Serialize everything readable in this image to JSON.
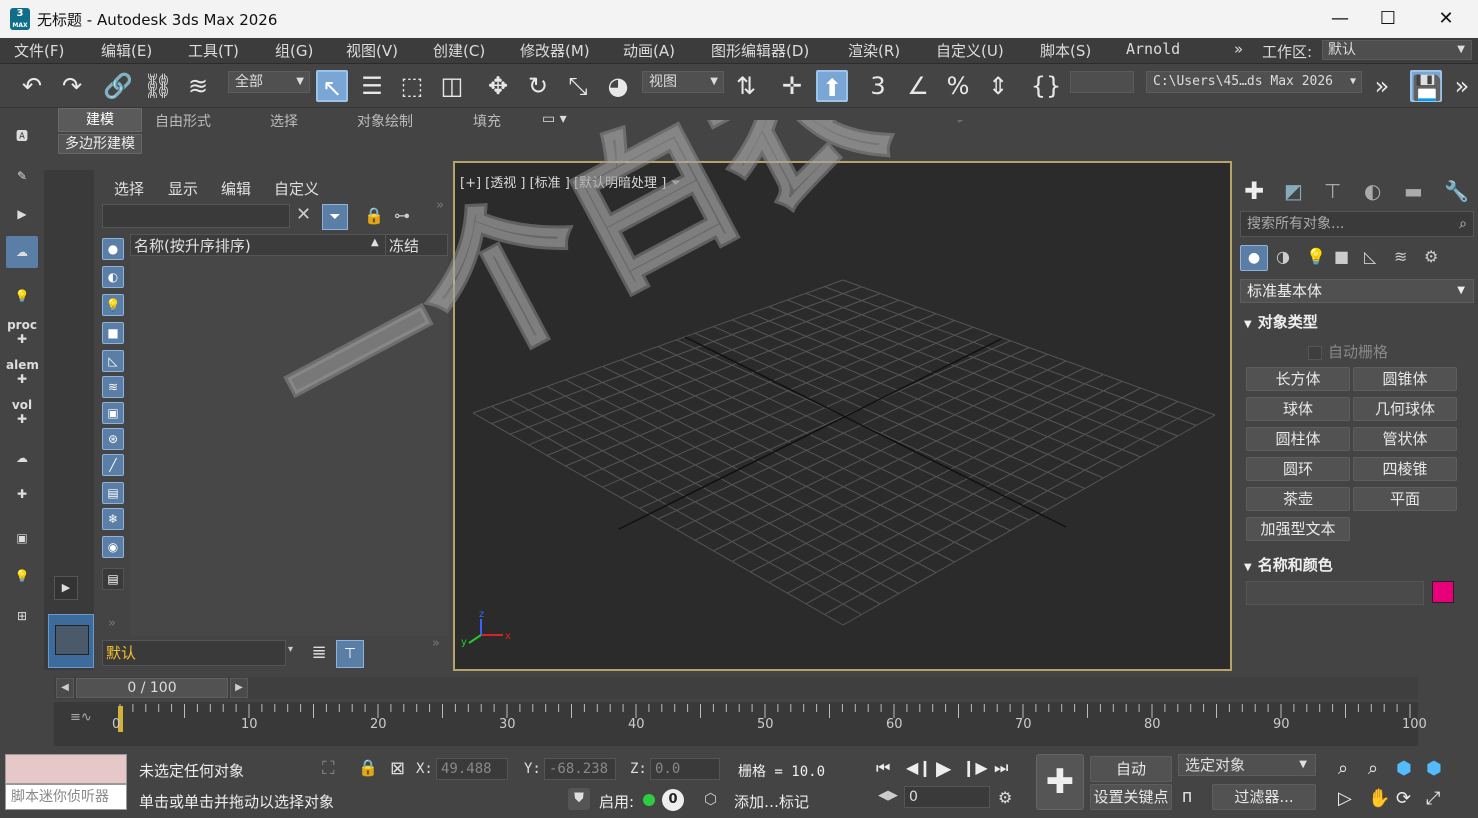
{
  "window": {
    "title": "无标题 - Autodesk 3ds Max 2026",
    "app_icon_text": "3",
    "app_icon_sub": "MAX",
    "minimize": "—",
    "maximize": "☐",
    "close": "✕"
  },
  "menu": {
    "items": [
      "文件(F)",
      "编辑(E)",
      "工具(T)",
      "组(G)",
      "视图(V)",
      "创建(C)",
      "修改器(M)",
      "动画(A)",
      "图形编辑器(D)",
      "渲染(R)",
      "自定义(U)",
      "脚本(S)",
      "Arnold"
    ],
    "more": "»",
    "workspace_label": "工作区:",
    "workspace_value": "默认"
  },
  "toolbar": {
    "selection_filter": "全部",
    "reference_coord": "视图",
    "project_path": "C:\\Users\\45…ds Max 2026",
    "more": "»"
  },
  "ribbon": {
    "tabs": [
      "建模",
      "自由形式",
      "选择",
      "对象绘制",
      "填充"
    ],
    "active_tab": "建模",
    "subtab": "多边形建模"
  },
  "left_toolbar": {
    "proc": "proc",
    "alem": "alem",
    "vol": "vol"
  },
  "explorer": {
    "menus": [
      "选择",
      "显示",
      "编辑",
      "自定义"
    ],
    "col_name": "名称(按升序排序)",
    "col_sort": "▲",
    "col_frozen": "冻结",
    "layer": "默认",
    "more": "»"
  },
  "viewport": {
    "label": "[+] [透视 ] [标准 ] [默认明暗处理 ]",
    "watermark": "一个白衣书图",
    "axis_x": "x",
    "axis_y": "y",
    "axis_z": "z"
  },
  "command_panel": {
    "search_placeholder": "搜索所有对象...",
    "category": "标准基本体",
    "object_type_title": "对象类型",
    "autogrid": "自动栅格",
    "buttons": [
      "长方体",
      "圆锥体",
      "球体",
      "几何球体",
      "圆柱体",
      "管状体",
      "圆环",
      "四棱锥",
      "茶壶",
      "平面",
      "加强型文本"
    ],
    "name_color_title": "名称和颜色",
    "object_color": "#e8007a"
  },
  "timeline": {
    "frame": "0 / 100",
    "ticks": [
      "0",
      "10",
      "20",
      "30",
      "40",
      "50",
      "60",
      "70",
      "80",
      "90",
      "100"
    ]
  },
  "status": {
    "maxscript_label": "脚本迷你侦听器",
    "selection_msg": "未选定任何对象",
    "prompt_msg": "单击或单击并拖动以选择对象",
    "x_label": "X:",
    "x_value": "49.488",
    "y_label": "Y:",
    "y_value": "-68.238",
    "z_label": "Z:",
    "z_value": "0.0",
    "grid": "栅格 = 10.0",
    "enable_label": "启用:",
    "enable_count": "0",
    "add_tag": "添加…标记",
    "auto_key": "自动",
    "set_key": "设置关键点",
    "key_filter_select": "选定对象",
    "filters": "过滤器...",
    "current_frame": "0"
  }
}
